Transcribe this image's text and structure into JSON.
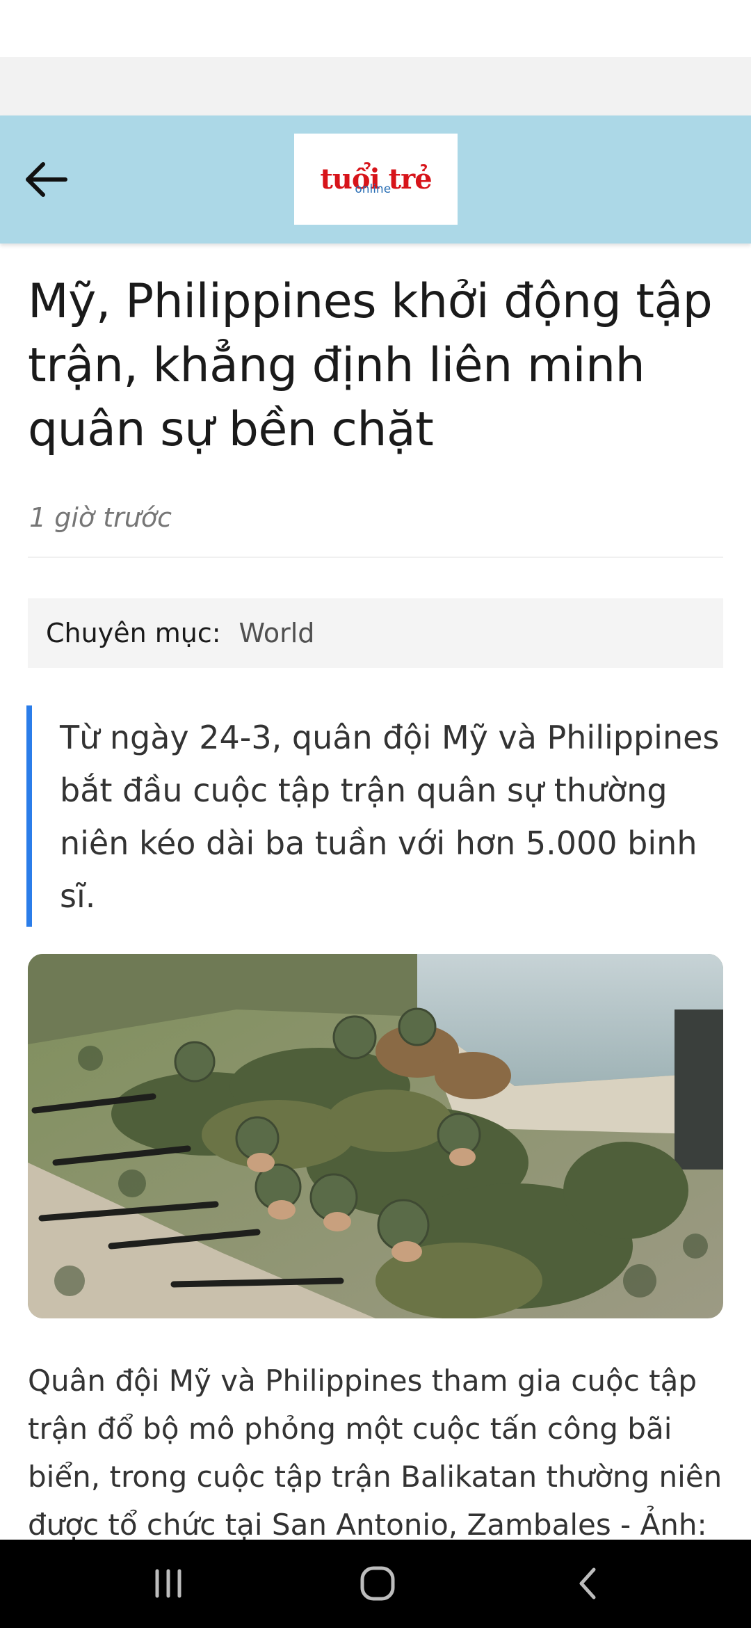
{
  "header": {
    "back_icon": "arrow-left-icon",
    "logo": "tuổi trẻ online",
    "logo_main": "tuổi trẻ",
    "logo_sub": "online",
    "logo_color": "#d7141a",
    "background_color": "#acd8e7"
  },
  "article": {
    "title": "Mỹ, Philippines khởi động tập trận, khẳng định liên minh quân sự bền chặt",
    "time": "1 giờ trước",
    "category": {
      "label": "Chuyên mục:",
      "value": "World"
    },
    "lead": "Từ ngày 24-3, quân đội Mỹ và Philippines bắt đầu cuộc tập trận quân sự thường niên kéo dài ba tuần với hơn 5.000 binh sĩ.",
    "lead_accent_color": "#2b7de9",
    "photo": "soldiers-exercise-photo",
    "caption": "Quân đội Mỹ và Philippines tham gia cuộc tập trận đổ bộ mô phỏng một cuộc tấn công bãi biển, trong cuộc tập trận Balikatan thường niên được tổ chức tại San Antonio, Zambales - Ảnh:"
  },
  "nav": {
    "recents_icon": "recents-icon",
    "home_icon": "home-icon",
    "back_icon": "back-chevron-icon"
  }
}
